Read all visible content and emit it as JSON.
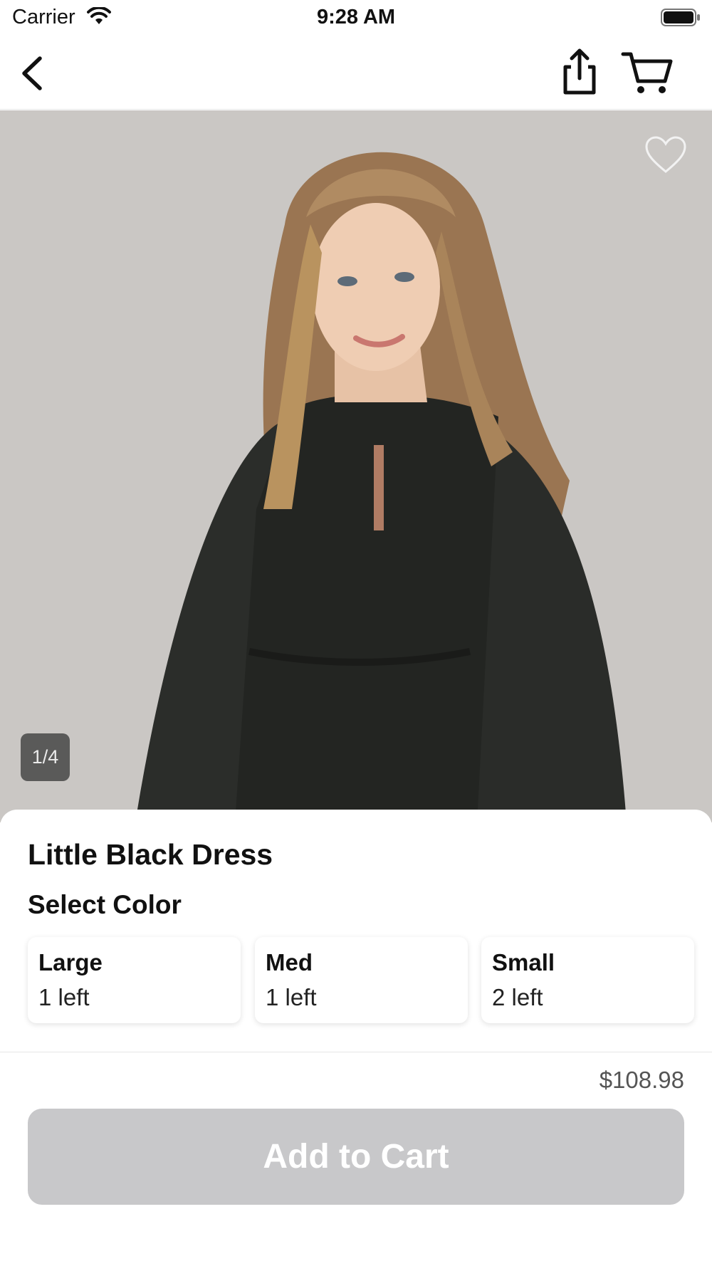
{
  "status_bar": {
    "carrier": "Carrier",
    "time": "9:28 AM"
  },
  "nav": {
    "back_icon": "chevron-left-icon",
    "share_icon": "share-icon",
    "cart_icon": "cart-icon"
  },
  "hero": {
    "favorite_icon": "heart-outline-icon",
    "page_indicator": "1/4"
  },
  "product": {
    "title": "Little Black Dress",
    "select_label": "Select Color",
    "options": [
      {
        "name": "Large",
        "stock": "1 left"
      },
      {
        "name": "Med",
        "stock": "1 left"
      },
      {
        "name": "Small",
        "stock": "2 left"
      }
    ]
  },
  "purchase": {
    "price": "$108.98",
    "add_to_cart_label": "Add to Cart"
  },
  "colors": {
    "button_disabled": "#c8c8ca",
    "photo_background": "#c9c6c3"
  }
}
